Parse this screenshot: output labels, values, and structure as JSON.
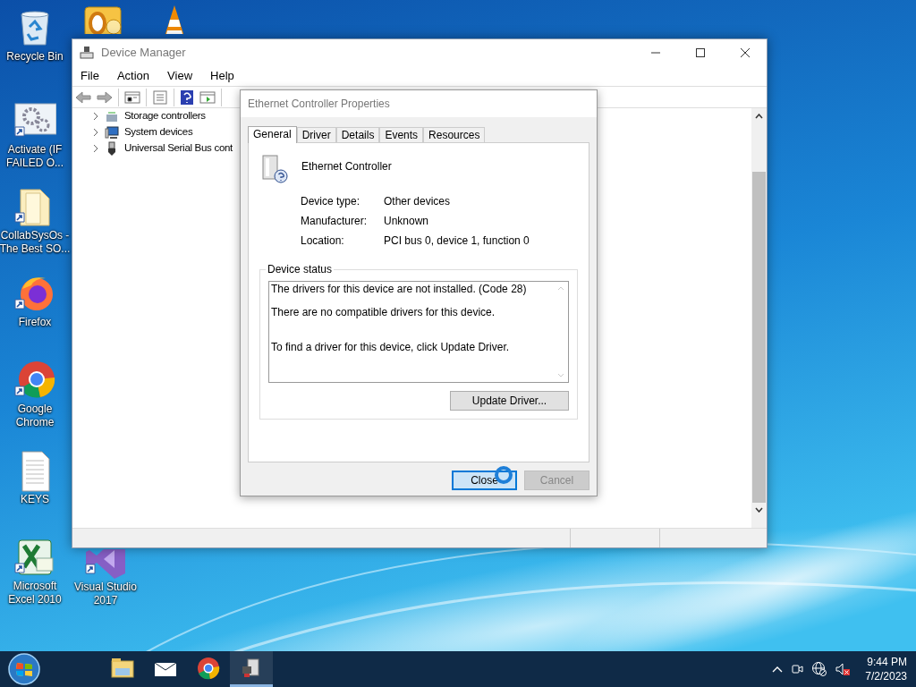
{
  "desktop_icons": [
    {
      "kind": "recycle-bin",
      "lines": [
        "Recycle Bin"
      ]
    },
    {
      "kind": "outlook"
    },
    {
      "kind": "vlc"
    },
    {
      "kind": "gears",
      "lines": [
        "Activate (IF",
        "FAILED O..."
      ]
    },
    {
      "kind": "folder",
      "lines": [
        "CollabSysOs -",
        "The Best SO..."
      ]
    },
    {
      "kind": "firefox",
      "lines": [
        "Firefox"
      ]
    },
    {
      "kind": "chrome",
      "lines": [
        "Google",
        "Chrome"
      ]
    },
    {
      "kind": "text-file",
      "lines": [
        "KEYS"
      ]
    },
    {
      "kind": "excel",
      "lines": [
        "Microsoft",
        "Excel 2010"
      ]
    },
    {
      "kind": "visual-studio",
      "lines": [
        "Visual Studio",
        "2017"
      ]
    }
  ],
  "device_manager": {
    "title": "Device Manager",
    "menu": [
      "File",
      "Action",
      "View",
      "Help"
    ],
    "tree": [
      {
        "label": "Storage controllers",
        "kind": "storage",
        "expanded": false
      },
      {
        "label": "System devices",
        "kind": "computer",
        "expanded": false
      },
      {
        "label": "Universal Serial Bus cont",
        "kind": "usb",
        "expanded": false
      }
    ]
  },
  "properties_dialog": {
    "title": "Ethernet Controller Properties",
    "tabs": [
      {
        "label": "General",
        "selected": true
      },
      {
        "label": "Driver",
        "selected": false
      },
      {
        "label": "Details",
        "selected": false
      },
      {
        "label": "Events",
        "selected": false
      },
      {
        "label": "Resources",
        "selected": false
      }
    ],
    "device_name": "Ethernet Controller",
    "fields": [
      {
        "label": "Device type:",
        "value": "Other devices"
      },
      {
        "label": "Manufacturer:",
        "value": "Unknown"
      },
      {
        "label": "Location:",
        "value": "PCI bus 0, device 1, function 0"
      }
    ],
    "status_group": "Device status",
    "status_text": "The drivers for this device are not installed. (Code 28)\n\nThere are no compatible drivers for this device.\n\n\nTo find a driver for this device, click Update Driver.",
    "update_button": "Update Driver...",
    "buttons": [
      {
        "label": "Close",
        "default": true,
        "disabled": false
      },
      {
        "label": "Cancel",
        "default": false,
        "disabled": true
      }
    ]
  },
  "taskbar": {
    "pinned": [
      {
        "kind": "explorer",
        "active": false
      },
      {
        "kind": "mail",
        "active": false
      },
      {
        "kind": "chrome",
        "active": false
      },
      {
        "kind": "device-manager",
        "active": true
      }
    ],
    "time": "9:44 PM",
    "date": "7/2/2023"
  }
}
